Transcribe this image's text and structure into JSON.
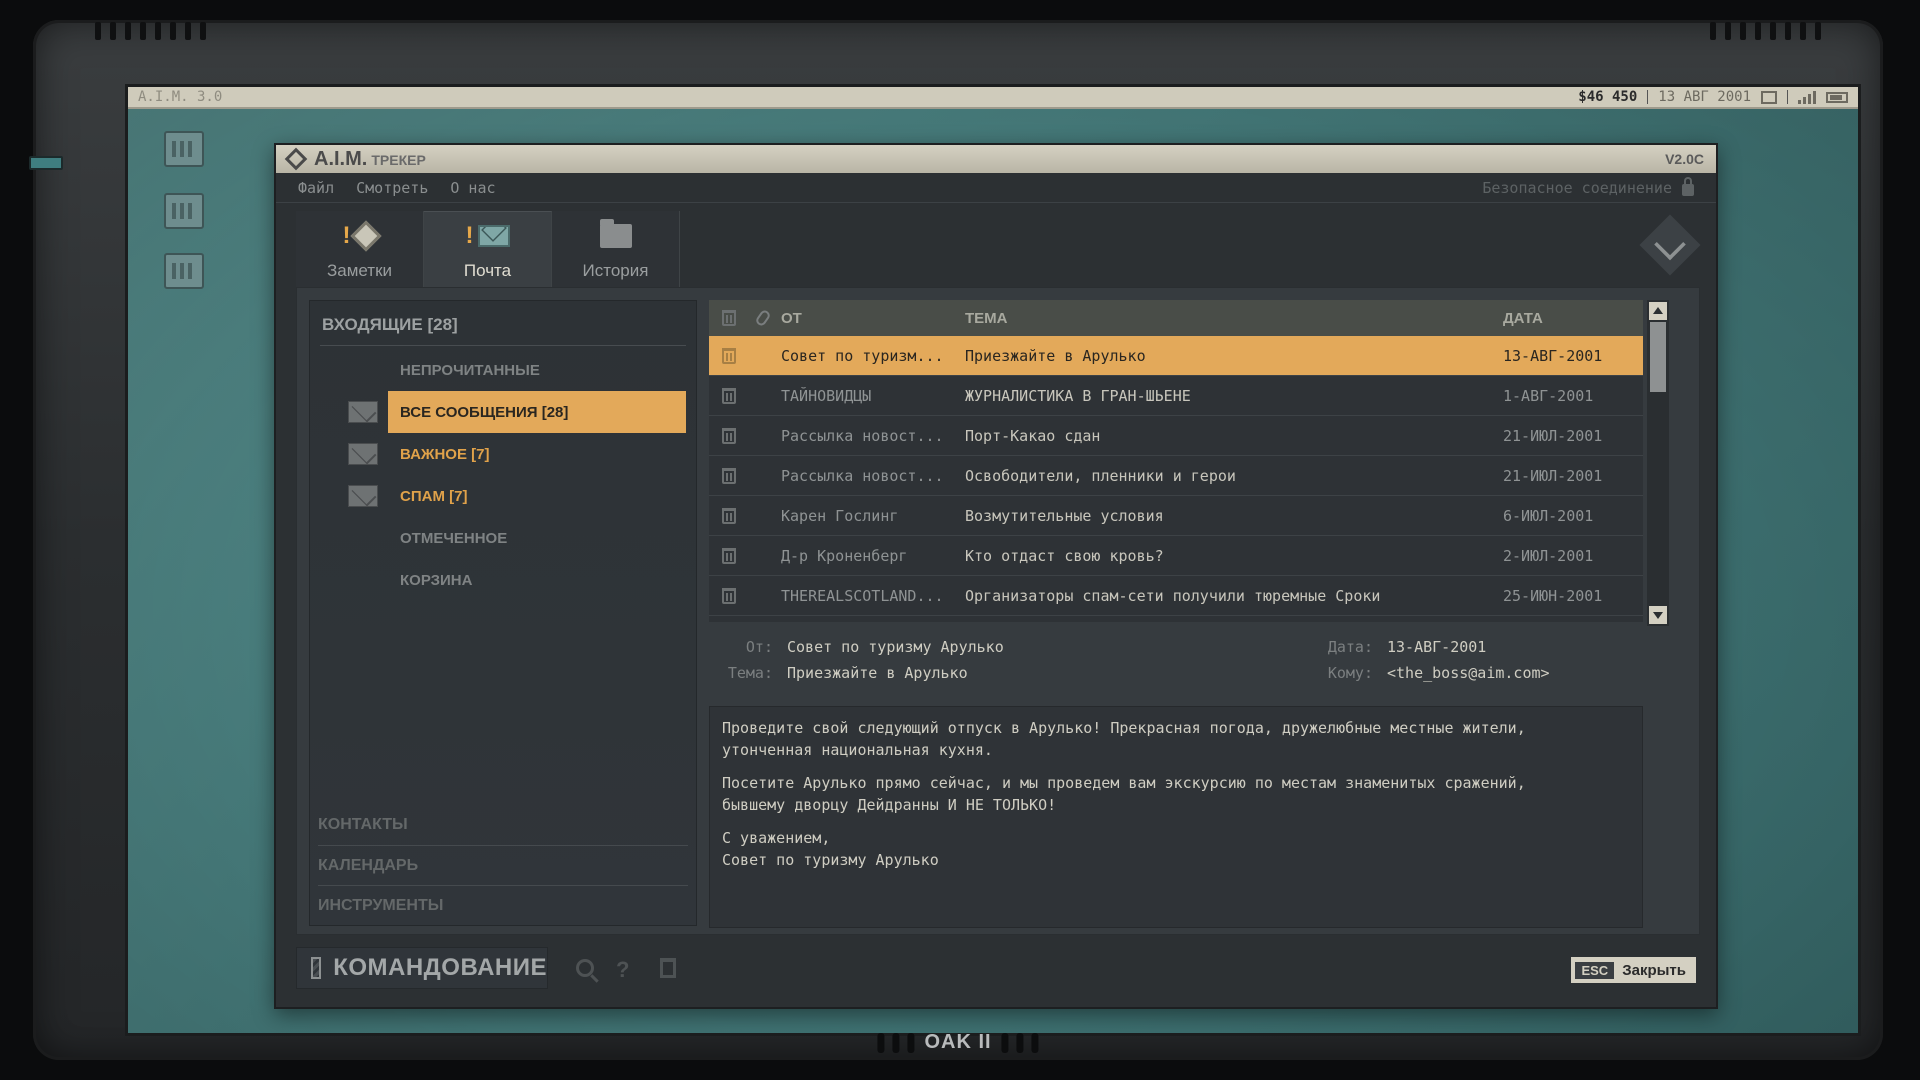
{
  "system": {
    "os_label": "A.I.M. 3.0",
    "money": "$46 450",
    "date": "13 АВГ 2001"
  },
  "window": {
    "app_name": "A.I.M.",
    "app_subtitle": "ТРЕКЕР",
    "version": "V2.0C",
    "menu": [
      "Файл",
      "Смотреть",
      "О нас"
    ],
    "secure_label": "Безопасное соединение"
  },
  "tabs": [
    {
      "label": "Заметки",
      "icon": "notes-icon",
      "alert": "!"
    },
    {
      "label": "Почта",
      "icon": "mail-icon",
      "alert": "!"
    },
    {
      "label": "История",
      "icon": "folder-icon",
      "alert": ""
    }
  ],
  "sidebar": {
    "inbox_title": "ВХОДЯЩИЕ [28]",
    "folders": [
      {
        "label": "НЕПРОЧИТАННЫЕ",
        "icon": ""
      },
      {
        "label": "ВСЕ СООБЩЕНИЯ [28]",
        "icon": "envelope-icon"
      },
      {
        "label": "ВАЖНОЕ [7]",
        "icon": "envelope-icon"
      },
      {
        "label": "СПАМ [7]",
        "icon": "envelope-icon"
      },
      {
        "label": "ОТМЕЧЕННОЕ",
        "icon": ""
      },
      {
        "label": "КОРЗИНА",
        "icon": ""
      }
    ],
    "bottom_links": [
      "КОНТАКТЫ",
      "КАЛЕНДАРЬ",
      "ИНСТРУМЕНТЫ"
    ]
  },
  "mail_table": {
    "headers": {
      "from": "ОТ",
      "subject": "ТЕМА",
      "date": "ДАТА"
    },
    "rows": [
      {
        "from": "Совет по туризм...",
        "subject": "Приезжайте в Арулько",
        "date": "13-АВГ-2001"
      },
      {
        "from": "ТАЙНОВИДЦЫ",
        "subject": "ЖУРНАЛИСТИКА В ГРАН-ШЬЕНЕ",
        "date": "1-АВГ-2001"
      },
      {
        "from": "Рассылка новост...",
        "subject": "Порт-Какао сдан",
        "date": "21-ИЮЛ-2001"
      },
      {
        "from": "Рассылка новост...",
        "subject": "Освободители, пленники и герои",
        "date": "21-ИЮЛ-2001"
      },
      {
        "from": "Карен Гослинг",
        "subject": "Возмутительные условия",
        "date": "6-ИЮЛ-2001"
      },
      {
        "from": "Д-р Кроненберг",
        "subject": "Кто отдаст свою кровь?",
        "date": "2-ИЮЛ-2001"
      },
      {
        "from": "THEREALSCOTLAND...",
        "subject": "Организаторы спам-сети получили тюремные Сроки",
        "date": "25-ИЮН-2001"
      }
    ]
  },
  "message": {
    "from_label": "От:",
    "from": "Совет по туризму Арулько",
    "subject_label": "Тема:",
    "subject": "Приезжайте в Арулько",
    "date_label": "Дата:",
    "date": "13-АВГ-2001",
    "to_label": "Кому:",
    "to": "<the_boss@aim.com>",
    "paragraphs": [
      "Проведите свой следующий отпуск в Арулько! Прекрасная погода, дружелюбные местные жители,\nутонченная национальная кухня.",
      "Посетите Арулько прямо сейчас, и мы проведем вам экскурсию по местам знаменитых сражений,\nбывшему дворцу Дейдранны И НЕ ТОЛЬКО!",
      "С уважением,\nСовет по туризму Арулько"
    ]
  },
  "footer": {
    "command_label": "КОМАНДОВАНИЕ",
    "esc_key": "ESC",
    "close_label": "Закрыть"
  },
  "device": {
    "brand": "OAK II"
  },
  "colors": {
    "accent": "#e3a95a",
    "screen": "#4f8c8c",
    "window": "#2c3033"
  }
}
